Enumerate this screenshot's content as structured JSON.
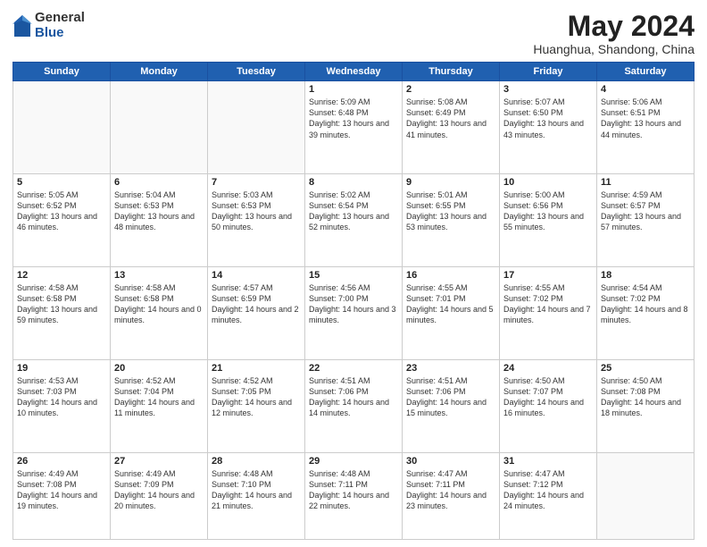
{
  "logo": {
    "general": "General",
    "blue": "Blue"
  },
  "title": "May 2024",
  "location": "Huanghua, Shandong, China",
  "days_of_week": [
    "Sunday",
    "Monday",
    "Tuesday",
    "Wednesday",
    "Thursday",
    "Friday",
    "Saturday"
  ],
  "weeks": [
    [
      {
        "day": "",
        "info": ""
      },
      {
        "day": "",
        "info": ""
      },
      {
        "day": "",
        "info": ""
      },
      {
        "day": "1",
        "info": "Sunrise: 5:09 AM\nSunset: 6:48 PM\nDaylight: 13 hours and 39 minutes."
      },
      {
        "day": "2",
        "info": "Sunrise: 5:08 AM\nSunset: 6:49 PM\nDaylight: 13 hours and 41 minutes."
      },
      {
        "day": "3",
        "info": "Sunrise: 5:07 AM\nSunset: 6:50 PM\nDaylight: 13 hours and 43 minutes."
      },
      {
        "day": "4",
        "info": "Sunrise: 5:06 AM\nSunset: 6:51 PM\nDaylight: 13 hours and 44 minutes."
      }
    ],
    [
      {
        "day": "5",
        "info": "Sunrise: 5:05 AM\nSunset: 6:52 PM\nDaylight: 13 hours and 46 minutes."
      },
      {
        "day": "6",
        "info": "Sunrise: 5:04 AM\nSunset: 6:53 PM\nDaylight: 13 hours and 48 minutes."
      },
      {
        "day": "7",
        "info": "Sunrise: 5:03 AM\nSunset: 6:53 PM\nDaylight: 13 hours and 50 minutes."
      },
      {
        "day": "8",
        "info": "Sunrise: 5:02 AM\nSunset: 6:54 PM\nDaylight: 13 hours and 52 minutes."
      },
      {
        "day": "9",
        "info": "Sunrise: 5:01 AM\nSunset: 6:55 PM\nDaylight: 13 hours and 53 minutes."
      },
      {
        "day": "10",
        "info": "Sunrise: 5:00 AM\nSunset: 6:56 PM\nDaylight: 13 hours and 55 minutes."
      },
      {
        "day": "11",
        "info": "Sunrise: 4:59 AM\nSunset: 6:57 PM\nDaylight: 13 hours and 57 minutes."
      }
    ],
    [
      {
        "day": "12",
        "info": "Sunrise: 4:58 AM\nSunset: 6:58 PM\nDaylight: 13 hours and 59 minutes."
      },
      {
        "day": "13",
        "info": "Sunrise: 4:58 AM\nSunset: 6:58 PM\nDaylight: 14 hours and 0 minutes."
      },
      {
        "day": "14",
        "info": "Sunrise: 4:57 AM\nSunset: 6:59 PM\nDaylight: 14 hours and 2 minutes."
      },
      {
        "day": "15",
        "info": "Sunrise: 4:56 AM\nSunset: 7:00 PM\nDaylight: 14 hours and 3 minutes."
      },
      {
        "day": "16",
        "info": "Sunrise: 4:55 AM\nSunset: 7:01 PM\nDaylight: 14 hours and 5 minutes."
      },
      {
        "day": "17",
        "info": "Sunrise: 4:55 AM\nSunset: 7:02 PM\nDaylight: 14 hours and 7 minutes."
      },
      {
        "day": "18",
        "info": "Sunrise: 4:54 AM\nSunset: 7:02 PM\nDaylight: 14 hours and 8 minutes."
      }
    ],
    [
      {
        "day": "19",
        "info": "Sunrise: 4:53 AM\nSunset: 7:03 PM\nDaylight: 14 hours and 10 minutes."
      },
      {
        "day": "20",
        "info": "Sunrise: 4:52 AM\nSunset: 7:04 PM\nDaylight: 14 hours and 11 minutes."
      },
      {
        "day": "21",
        "info": "Sunrise: 4:52 AM\nSunset: 7:05 PM\nDaylight: 14 hours and 12 minutes."
      },
      {
        "day": "22",
        "info": "Sunrise: 4:51 AM\nSunset: 7:06 PM\nDaylight: 14 hours and 14 minutes."
      },
      {
        "day": "23",
        "info": "Sunrise: 4:51 AM\nSunset: 7:06 PM\nDaylight: 14 hours and 15 minutes."
      },
      {
        "day": "24",
        "info": "Sunrise: 4:50 AM\nSunset: 7:07 PM\nDaylight: 14 hours and 16 minutes."
      },
      {
        "day": "25",
        "info": "Sunrise: 4:50 AM\nSunset: 7:08 PM\nDaylight: 14 hours and 18 minutes."
      }
    ],
    [
      {
        "day": "26",
        "info": "Sunrise: 4:49 AM\nSunset: 7:08 PM\nDaylight: 14 hours and 19 minutes."
      },
      {
        "day": "27",
        "info": "Sunrise: 4:49 AM\nSunset: 7:09 PM\nDaylight: 14 hours and 20 minutes."
      },
      {
        "day": "28",
        "info": "Sunrise: 4:48 AM\nSunset: 7:10 PM\nDaylight: 14 hours and 21 minutes."
      },
      {
        "day": "29",
        "info": "Sunrise: 4:48 AM\nSunset: 7:11 PM\nDaylight: 14 hours and 22 minutes."
      },
      {
        "day": "30",
        "info": "Sunrise: 4:47 AM\nSunset: 7:11 PM\nDaylight: 14 hours and 23 minutes."
      },
      {
        "day": "31",
        "info": "Sunrise: 4:47 AM\nSunset: 7:12 PM\nDaylight: 14 hours and 24 minutes."
      },
      {
        "day": "",
        "info": ""
      }
    ]
  ]
}
